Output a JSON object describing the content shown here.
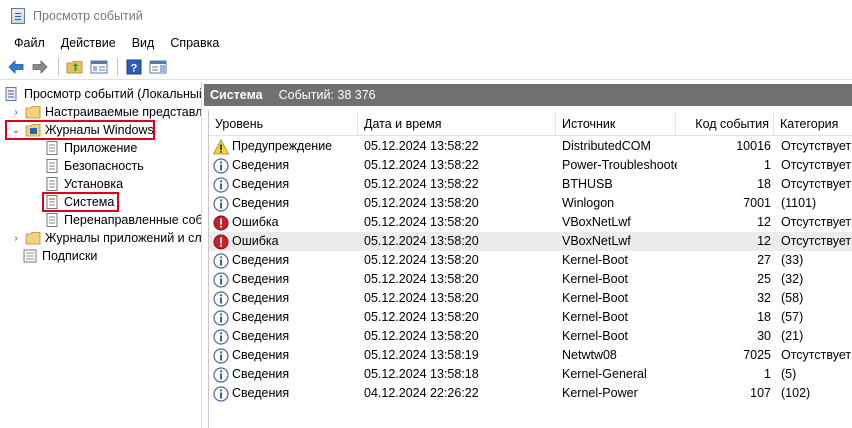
{
  "window": {
    "title": "Просмотр событий"
  },
  "menu": [
    "Файл",
    "Действие",
    "Вид",
    "Справка"
  ],
  "toolbar": {
    "buttons": [
      "back-arrow-icon",
      "forward-arrow-icon",
      "folder-up-icon",
      "show-hide-tree-icon",
      "help-icon",
      "action-pane-icon"
    ]
  },
  "tree": {
    "root": "Просмотр событий (Локальный)",
    "custom_views": "Настраиваемые представления",
    "windows_logs": "Журналы Windows",
    "application": "Приложение",
    "security": "Безопасность",
    "setup": "Установка",
    "system": "Система",
    "forwarded": "Перенаправленные события",
    "app_logs": "Журналы приложений и служб",
    "subscriptions": "Подписки"
  },
  "pane": {
    "title": "Система",
    "count": "Событий: 38 376"
  },
  "table": {
    "columns": [
      "Уровень",
      "Дата и время",
      "Источник",
      "Код события",
      "Категория"
    ],
    "rows": [
      {
        "level": "Предупреждение",
        "icon": "warning",
        "date": "05.12.2024 13:58:22",
        "source": "DistributedCOM",
        "id": "10016",
        "category": "Отсутствует"
      },
      {
        "level": "Сведения",
        "icon": "info",
        "date": "05.12.2024 13:58:22",
        "source": "Power-Troubleshooter",
        "id": "1",
        "category": "Отсутствует"
      },
      {
        "level": "Сведения",
        "icon": "info",
        "date": "05.12.2024 13:58:22",
        "source": "BTHUSB",
        "id": "18",
        "category": "Отсутствует"
      },
      {
        "level": "Сведения",
        "icon": "info",
        "date": "05.12.2024 13:58:20",
        "source": "Winlogon",
        "id": "7001",
        "category": "(1101)"
      },
      {
        "level": "Ошибка",
        "icon": "error",
        "date": "05.12.2024 13:58:20",
        "source": "VBoxNetLwf",
        "id": "12",
        "category": "Отсутствует"
      },
      {
        "level": "Ошибка",
        "icon": "error",
        "date": "05.12.2024 13:58:20",
        "source": "VBoxNetLwf",
        "id": "12",
        "category": "Отсутствует"
      },
      {
        "level": "Сведения",
        "icon": "info",
        "date": "05.12.2024 13:58:20",
        "source": "Kernel-Boot",
        "id": "27",
        "category": "(33)"
      },
      {
        "level": "Сведения",
        "icon": "info",
        "date": "05.12.2024 13:58:20",
        "source": "Kernel-Boot",
        "id": "25",
        "category": "(32)"
      },
      {
        "level": "Сведения",
        "icon": "info",
        "date": "05.12.2024 13:58:20",
        "source": "Kernel-Boot",
        "id": "32",
        "category": "(58)"
      },
      {
        "level": "Сведения",
        "icon": "info",
        "date": "05.12.2024 13:58:20",
        "source": "Kernel-Boot",
        "id": "18",
        "category": "(57)"
      },
      {
        "level": "Сведения",
        "icon": "info",
        "date": "05.12.2024 13:58:20",
        "source": "Kernel-Boot",
        "id": "30",
        "category": "(21)"
      },
      {
        "level": "Сведения",
        "icon": "info",
        "date": "05.12.2024 13:58:19",
        "source": "Netwtw08",
        "id": "7025",
        "category": "Отсутствует"
      },
      {
        "level": "Сведения",
        "icon": "info",
        "date": "05.12.2024 13:58:18",
        "source": "Kernel-General",
        "id": "1",
        "category": "(5)"
      },
      {
        "level": "Сведения",
        "icon": "info",
        "date": "04.12.2024 22:26:22",
        "source": "Kernel-Power",
        "id": "107",
        "category": "(102)"
      }
    ]
  },
  "colors": {
    "highlight": "#e0001b",
    "pane_header": "#707070",
    "selected_row": "#ececec"
  }
}
